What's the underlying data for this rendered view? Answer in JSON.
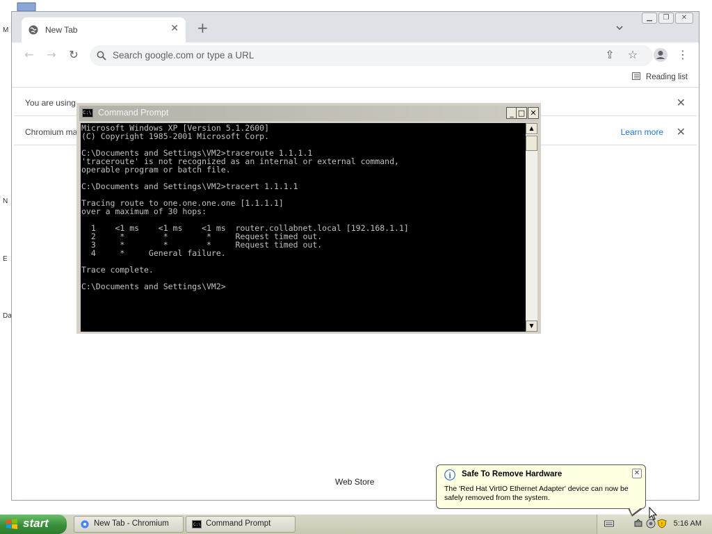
{
  "desktop": {
    "labels": [
      "M",
      "N",
      "E",
      "Da"
    ]
  },
  "browser": {
    "tab": {
      "title": "New Tab",
      "icon": "globe-icon"
    },
    "omnibox": {
      "placeholder": "Search google.com or type a URL"
    },
    "reading_list": "Reading list",
    "infobar1": {
      "text": "You are using"
    },
    "infobar2": {
      "text": "Chromium ma",
      "link": "Learn more"
    },
    "webstore_label": "Web Store",
    "accent": "#1a73e8"
  },
  "cmd": {
    "title": "Command Prompt",
    "lines": [
      "Microsoft Windows XP [Version 5.1.2600]",
      "(C) Copyright 1985-2001 Microsoft Corp.",
      "",
      "C:\\Documents and Settings\\VM2>traceroute 1.1.1.1",
      "'traceroute' is not recognized as an internal or external command,",
      "operable program or batch file.",
      "",
      "C:\\Documents and Settings\\VM2>tracert 1.1.1.1",
      "",
      "Tracing route to one.one.one.one [1.1.1.1]",
      "over a maximum of 30 hops:",
      "",
      "  1    <1 ms    <1 ms    <1 ms  router.collabnet.local [192.168.1.1]",
      "  2     *        *        *     Request timed out.",
      "  3     *        *        *     Request timed out.",
      "  4     *     General failure.",
      "",
      "Trace complete.",
      "",
      "C:\\Documents and Settings\\VM2>"
    ]
  },
  "taskbar": {
    "start_label": "start",
    "buttons": [
      {
        "label": "New Tab - Chromium"
      },
      {
        "label": "Command Prompt"
      }
    ],
    "clock": "5:16 AM"
  },
  "balloon": {
    "title": "Safe To Remove Hardware",
    "body": "The 'Red Hat VirtIO Ethernet Adapter' device can now be safely removed from the system."
  }
}
